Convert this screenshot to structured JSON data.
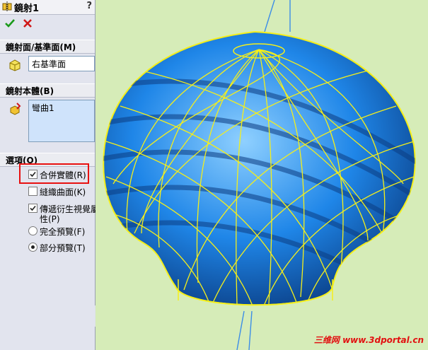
{
  "panel": {
    "title": "鏡射1",
    "help_label": "?"
  },
  "sections": {
    "mirror_face": {
      "header": "鏡射面/基準面(M)",
      "value": "右基準面"
    },
    "bodies": {
      "header": "鏡射本體(B)",
      "items": [
        "彎曲1"
      ]
    },
    "options": {
      "header": "選項(O)",
      "merge_solids": "合併實體(R)",
      "knit_surfaces": "縫織曲面(K)",
      "propagate_visual_1": "傳遞衍生視覺屬",
      "propagate_visual_2": "性(P)",
      "full_preview": "完全預覽(F)",
      "partial_preview": "部分預覽(T)"
    }
  },
  "state": {
    "merge_solids": true,
    "knit_surfaces": false,
    "propagate_visual": true,
    "preview_mode": "partial"
  },
  "watermark": "三维网 www.3dportal.cn",
  "colors": {
    "viewport_bg": "#d6ecb8",
    "model_blue": "#1a7fe6",
    "wireframe_yellow": "#f5ef1a",
    "highlight_red": "#e81010"
  }
}
